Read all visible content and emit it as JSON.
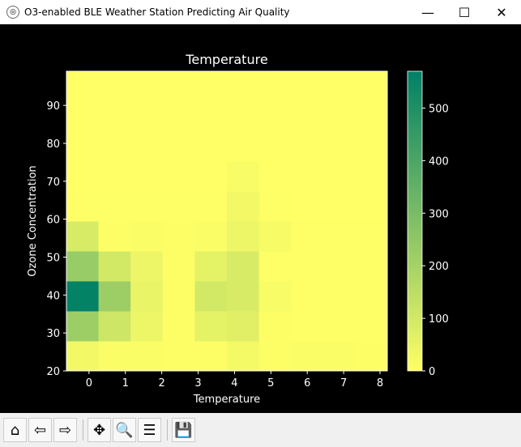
{
  "window": {
    "title": "O3-enabled BLE Weather Station Predicting Air Quality",
    "minimize": "—",
    "maximize": "☐",
    "close": "✕"
  },
  "toolbar": [
    {
      "name": "home",
      "glyph": "⌂"
    },
    {
      "name": "back",
      "glyph": "⇦"
    },
    {
      "name": "forward",
      "glyph": "⇨"
    },
    {
      "name": "pan",
      "glyph": "✥"
    },
    {
      "name": "zoom",
      "glyph": "🔍"
    },
    {
      "name": "configure-subplots",
      "glyph": "☰"
    },
    {
      "name": "save",
      "glyph": "💾"
    }
  ],
  "chart_data": {
    "type": "heatmap",
    "title": "Temperature",
    "xlabel": "Temperature",
    "ylabel": "Ozone Concentration",
    "xlim": [
      -0.62,
      8.2
    ],
    "ylim": [
      20,
      99
    ],
    "xticks": [
      0,
      1,
      2,
      3,
      4,
      5,
      6,
      7,
      8
    ],
    "yticks": [
      20,
      30,
      40,
      50,
      60,
      70,
      80,
      90
    ],
    "x_bins": 10,
    "y_bins": 10,
    "colormap": "summer_r",
    "colorbar": {
      "min": 0,
      "max": 570,
      "ticks": [
        0,
        100,
        200,
        300,
        400,
        500
      ]
    },
    "counts_rows_bottom_to_top": [
      [
        30,
        10,
        10,
        5,
        5,
        25,
        5,
        10,
        10,
        5
      ],
      [
        220,
        110,
        40,
        5,
        60,
        70,
        5,
        3,
        3,
        3
      ],
      [
        560,
        220,
        50,
        5,
        100,
        90,
        15,
        3,
        3,
        3
      ],
      [
        230,
        100,
        40,
        5,
        60,
        90,
        3,
        3,
        3,
        3
      ],
      [
        90,
        5,
        10,
        5,
        10,
        40,
        20,
        2,
        2,
        2
      ],
      [
        3,
        3,
        3,
        3,
        3,
        30,
        3,
        1,
        1,
        1
      ],
      [
        1,
        1,
        1,
        1,
        1,
        15,
        1,
        0,
        0,
        0
      ],
      [
        0,
        0,
        0,
        0,
        0,
        0,
        0,
        0,
        0,
        0
      ],
      [
        0,
        0,
        0,
        0,
        0,
        0,
        0,
        0,
        0,
        0
      ],
      [
        0,
        0,
        0,
        0,
        0,
        0,
        0,
        0,
        0,
        0
      ]
    ]
  }
}
